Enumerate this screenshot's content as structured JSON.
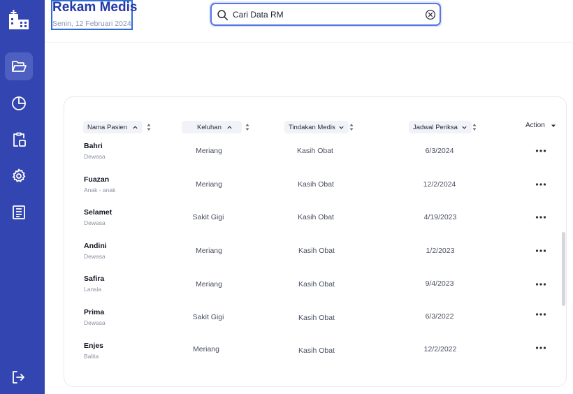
{
  "header": {
    "title": "Rekam Medis",
    "date": "Senin, 12 Februari 2024"
  },
  "search": {
    "value": "Cari Data RM",
    "placeholder": "Cari Data RM"
  },
  "sidebar": {
    "items": [
      {
        "icon": "folder-open-icon",
        "active": true
      },
      {
        "icon": "pie-chart-icon",
        "active": false
      },
      {
        "icon": "clipboard-icon",
        "active": false
      },
      {
        "icon": "gear-icon",
        "active": false
      },
      {
        "icon": "document-list-icon",
        "active": false
      }
    ],
    "logout_icon": "logout-icon"
  },
  "table": {
    "columns": {
      "name": "Nama Pasien",
      "complaint": "Keluhan",
      "action_medis": "Tindakan Medis",
      "schedule": "Jadwal Periksa",
      "action": "Action"
    },
    "rows": [
      {
        "name": "Bahri",
        "category": "Dewasa",
        "complaint": "Meriang",
        "treatment": "Kasih Obat",
        "date": "6/3/2024"
      },
      {
        "name": "Fuazan",
        "category": "Anak - anak",
        "complaint": "Meriang",
        "treatment": "Kasih Obat",
        "date": "12/2/2024"
      },
      {
        "name": "Selamet",
        "category": "Dewasa",
        "complaint": "Sakit Gigi",
        "treatment": "Kasih Obat",
        "date": "4/19/2023"
      },
      {
        "name": "Andini",
        "category": "Dewasa",
        "complaint": "Meriang",
        "treatment": "Kasih Obat",
        "date": "1/2/2023"
      },
      {
        "name": "Safira",
        "category": "Lansia",
        "complaint": "Meriang",
        "treatment": "Kasih Obat",
        "date": "9/4/2023"
      },
      {
        "name": "Prima",
        "category": "Dewasa",
        "complaint": "Sakit Gigi",
        "treatment": "Kasih Obat",
        "date": "6/3/2022"
      },
      {
        "name": "Enjes",
        "category": "Balita",
        "complaint": "Meriang",
        "treatment": "Kasih Obat",
        "date": "12/2/2022"
      }
    ]
  },
  "colors": {
    "sidebar": "#3345b0",
    "accent": "#2438a8",
    "search_border": "#5477e0"
  }
}
